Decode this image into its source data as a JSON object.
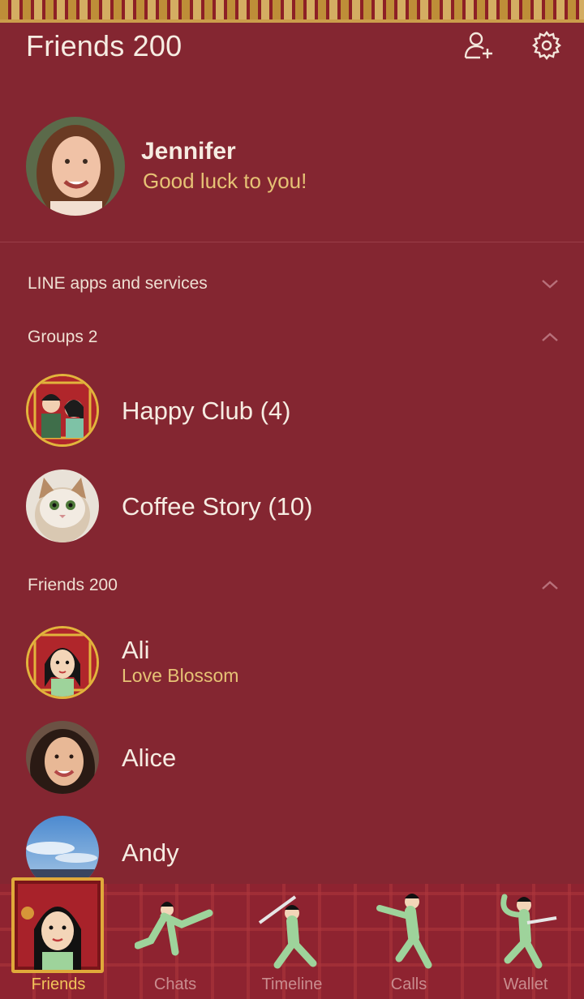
{
  "header": {
    "title": "Friends 200",
    "add_friend_icon": "add-friend-icon",
    "settings_icon": "gear-icon"
  },
  "profile": {
    "name": "Jennifer",
    "status": "Good luck to you!"
  },
  "sections": {
    "line_apps": {
      "label": "LINE apps and services",
      "state": "collapsed"
    },
    "groups": {
      "label": "Groups 2",
      "state": "expanded"
    },
    "friends": {
      "label": "Friends 200",
      "state": "expanded"
    }
  },
  "groups": [
    {
      "name": "Happy Club (4)"
    },
    {
      "name": "Coffee Story (10)"
    }
  ],
  "friends": [
    {
      "name": "Ali",
      "status": "Love Blossom"
    },
    {
      "name": "Alice"
    },
    {
      "name": "Andy"
    }
  ],
  "tabs": [
    {
      "label": "Friends",
      "active": true
    },
    {
      "label": "Chats"
    },
    {
      "label": "Timeline"
    },
    {
      "label": "Calls"
    },
    {
      "label": "Wallet"
    }
  ],
  "colors": {
    "background": "#842631",
    "accent_gold": "#e6c275",
    "active_tab": "#f1c35a",
    "inactive_tab": "#c98c8e"
  }
}
